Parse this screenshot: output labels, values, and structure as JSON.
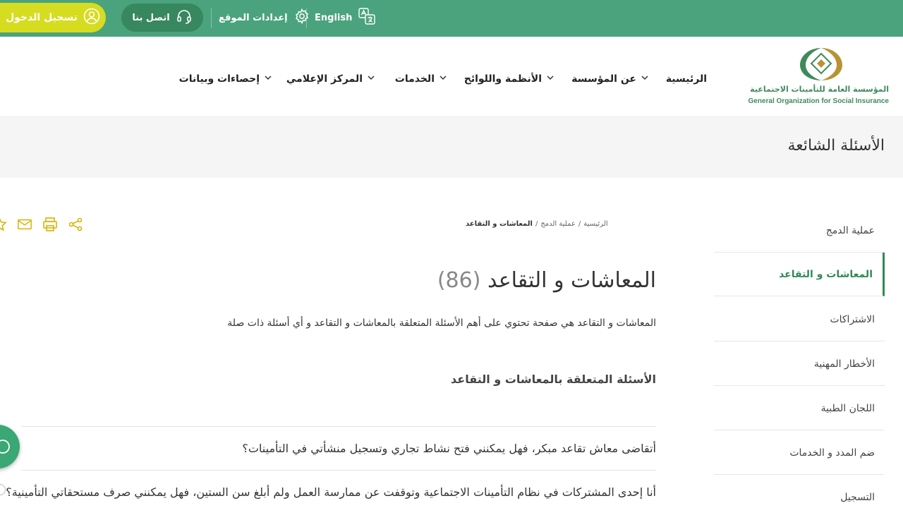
{
  "topbar": {
    "login_label": "تسجيل الدخول",
    "contact_label": "اتصل بنا",
    "settings_label": "إعدادات الموقع",
    "language_label": "English"
  },
  "logo": {
    "arabic": "المؤسسة العامة للتأمينات الاجتماعية",
    "english": "General Organization for Social Insurance"
  },
  "nav": {
    "items": [
      {
        "label": "الرئيسية",
        "has_dropdown": false
      },
      {
        "label": "عن المؤسسة",
        "has_dropdown": true
      },
      {
        "label": "الأنظمة واللوائح",
        "has_dropdown": true
      },
      {
        "label": "الخدمات",
        "has_dropdown": true
      },
      {
        "label": "المركز الإعلامي",
        "has_dropdown": true
      },
      {
        "label": "إحصاءات وبيانات",
        "has_dropdown": true
      }
    ]
  },
  "page": {
    "title": "الأسئلة الشائعة"
  },
  "breadcrumb": {
    "items": [
      "الرئيسية",
      "عملية الدمج",
      "المعاشات و التقاعد"
    ],
    "separator": "/"
  },
  "sidebar": {
    "items": [
      {
        "label": "عملية الدمج",
        "active": false
      },
      {
        "label": "المعاشات و التقاعد",
        "active": true
      },
      {
        "label": "الاشتراكات",
        "active": false
      },
      {
        "label": "الأخطار المهنية",
        "active": false
      },
      {
        "label": "اللجان الطبية",
        "active": false
      },
      {
        "label": "ضم المدد و الخدمات",
        "active": false
      },
      {
        "label": "التسجيل",
        "active": false
      }
    ]
  },
  "content": {
    "heading": "المعاشات و التقاعد",
    "count": "(86)",
    "description": "المعاشات و التقاعد هي صفحة تحتوي على أهم الأسئلة المتعلقة بالمعاشات و التقاعد و أي أسئلة ذات صلة",
    "subheading": "الأسئلة المتعلقة بالمعاشات و التقاعد",
    "faqs": [
      "أتقاضى معاش تقاعد مبكر، فهل يمكنني فتح نشاط تجاري وتسجيل منشأتي في التأمينات؟",
      "أنا إحدى المشتركات في نظام التأمينات الاجتماعية وتوقفت عن ممارسة العمل ولم أبلغ سن الستين، فهل يمكنني صرف مستحقاتي التأمينية؟"
    ]
  },
  "colors": {
    "topbar": "#4aa37c",
    "login": "#d6dc1f",
    "accent": "#2f8a55",
    "tools": "#d6b400"
  },
  "icons": {
    "login": "user-circle-icon",
    "contact": "headset-icon",
    "settings": "gear-icon",
    "language": "translate-icon",
    "share": "share-icon",
    "print": "print-icon",
    "email": "mail-icon",
    "favorite": "star-icon"
  }
}
